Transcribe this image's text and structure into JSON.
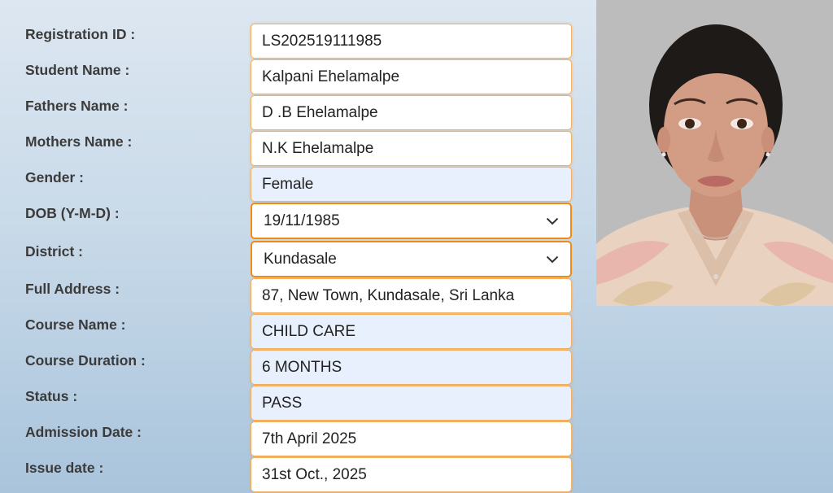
{
  "form": {
    "fields": [
      {
        "label": "Registration ID :",
        "value": "LS202519111985"
      },
      {
        "label": "Student Name :",
        "value": "Kalpani Ehelamalpe"
      },
      {
        "label": "Fathers Name :",
        "value": "D .B Ehelamalpe"
      },
      {
        "label": "Mothers Name :",
        "value": "N.K Ehelamalpe"
      },
      {
        "label": "Gender :",
        "value": "Female"
      },
      {
        "label": "DOB (Y-M-D) :",
        "value": "19/11/1985"
      },
      {
        "label": "District :",
        "value": "Kundasale"
      },
      {
        "label": "Full Address :",
        "value": "87, New Town, Kundasale, Sri Lanka"
      },
      {
        "label": "Course Name :",
        "value": "CHILD CARE"
      },
      {
        "label": "Course Duration :",
        "value": "6 MONTHS"
      },
      {
        "label": "Status :",
        "value": "PASS"
      },
      {
        "label": "Admission Date :",
        "value": "7th April 2025"
      },
      {
        "label": "Issue date :",
        "value": "31st Oct., 2025"
      }
    ]
  },
  "photo": {
    "icon": "student-portrait",
    "background_color": "#bdbdbd"
  },
  "colors": {
    "field_border": "#f2b064",
    "select_border": "#f08a12",
    "readonly_field_bg": "#e8f0fe",
    "label_text": "#3b3b3b"
  }
}
